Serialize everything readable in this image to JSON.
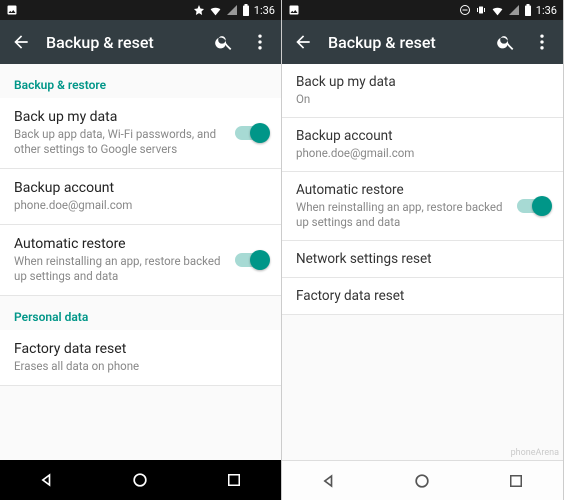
{
  "statusbar": {
    "time": "1:36"
  },
  "appbar": {
    "title": "Backup & reset"
  },
  "left": {
    "section_backup": "Backup & restore",
    "backup_data_title": "Back up my data",
    "backup_data_sub": "Back up app data, Wi-Fi passwords, and other settings to Google servers",
    "backup_account_title": "Backup account",
    "backup_account_sub": "phone.doe@gmail.com",
    "auto_restore_title": "Automatic restore",
    "auto_restore_sub": "When reinstalling an app, restore backed up settings and data",
    "section_personal": "Personal data",
    "factory_title": "Factory data reset",
    "factory_sub": "Erases all data on phone"
  },
  "right": {
    "backup_data_title": "Back up my data",
    "backup_data_sub": "On",
    "backup_account_title": "Backup account",
    "backup_account_sub": "phone.doe@gmail.com",
    "auto_restore_title": "Automatic restore",
    "auto_restore_sub": "When reinstalling an app, restore backed up settings and data",
    "network_reset_title": "Network settings reset",
    "factory_title": "Factory data reset"
  },
  "watermark": "phoneArena"
}
